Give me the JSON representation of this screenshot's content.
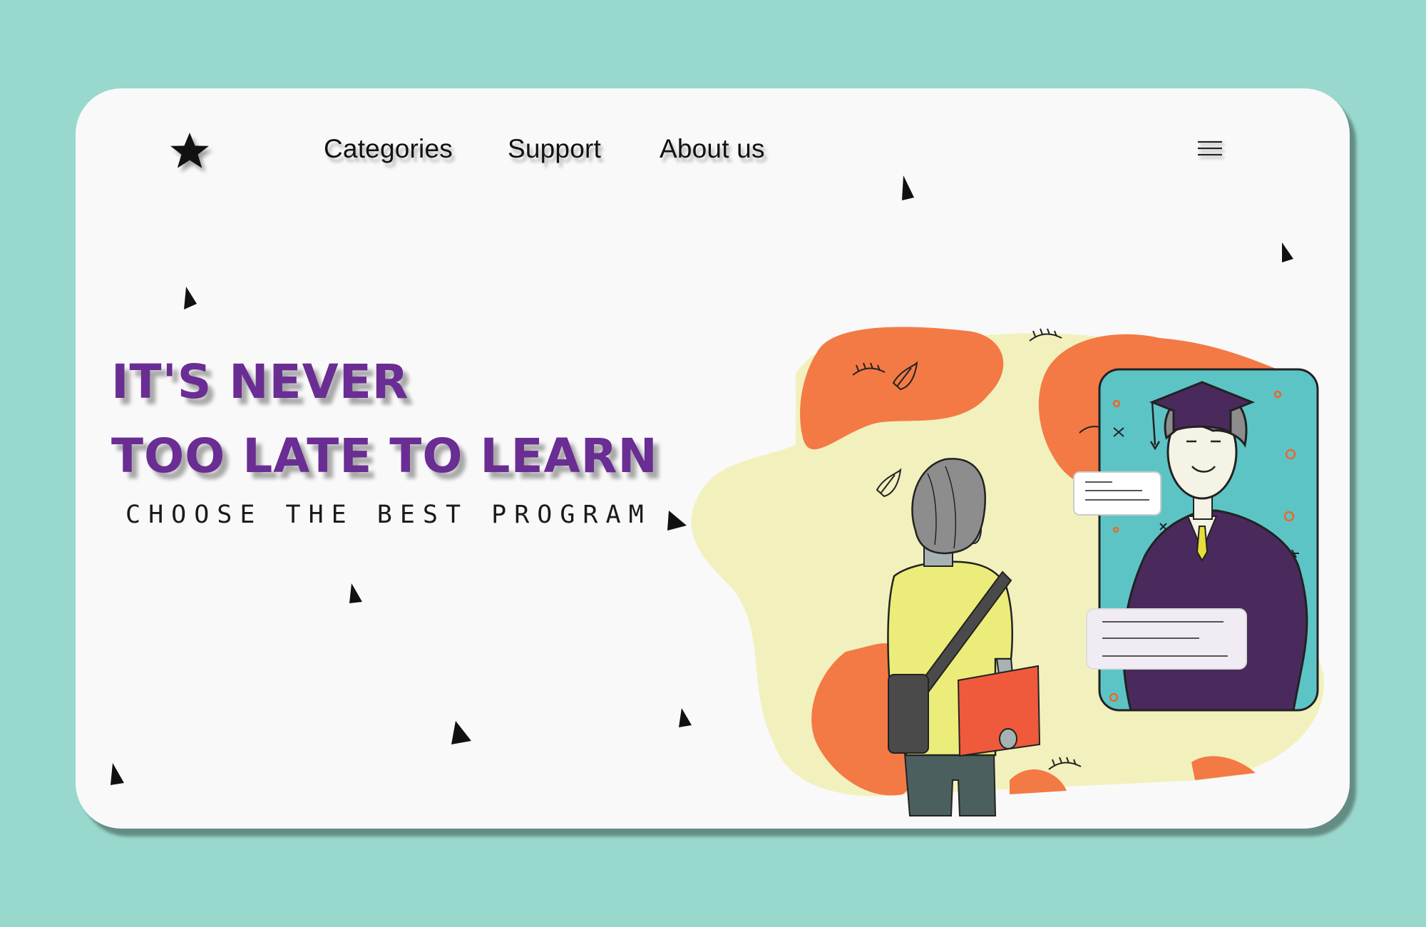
{
  "nav": {
    "items": [
      "Categories",
      "Support",
      "About us"
    ]
  },
  "hero": {
    "headline_line1": "It's never",
    "headline_line2": "too late to learn",
    "subheadline": "CHOOSE THE BEST PROGRAM"
  },
  "icons": {
    "logo": "star-icon",
    "menu": "hamburger-menu-icon"
  },
  "colors": {
    "background": "#99d8cc",
    "card": "#f9f9f9",
    "headline": "#6a2d93",
    "orange_blob": "#f37a45",
    "yellow_blob": "#f2f1bd",
    "phone_screen": "#5dc4c6",
    "student_shirt": "#ecec7a",
    "book": "#ef5a3c",
    "graduate_suit": "#4a2a5c"
  }
}
